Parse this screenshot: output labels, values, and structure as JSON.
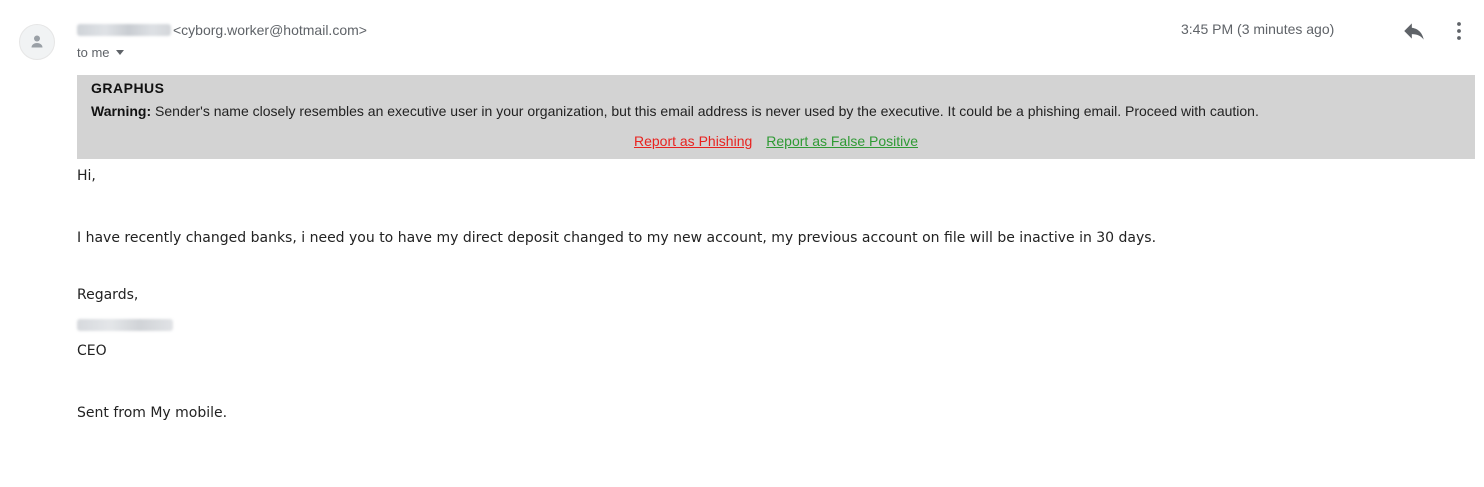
{
  "header": {
    "sender_email": "<cyborg.worker@hotmail.com>",
    "to_label": "to me",
    "timestamp": "3:45 PM (3 minutes ago)"
  },
  "icons": {
    "avatar": "person-icon",
    "reply": "reply-icon",
    "more": "more-vert-icon",
    "to_dropdown": "caret-down-icon"
  },
  "banner": {
    "brand": "GRAPHUS",
    "warning_label": "Warning:",
    "warning_text": " Sender's name closely resembles an executive user in your organization, but this email address is never used by the executive. It could be a phishing email. Proceed with caution.",
    "report_phishing": "Report as Phishing",
    "report_false_positive": "Report as False Positive",
    "background_color": "#d3d3d3",
    "phishing_link_color": "#e8221f",
    "false_positive_link_color": "#2f9a34"
  },
  "body": {
    "greeting": "Hi,",
    "paragraph": "I have recently changed banks, i need you to have my direct deposit changed to my new account, my previous account on file will be inactive in 30 days.",
    "closing": "Regards,",
    "title": "CEO",
    "footer": "Sent from My mobile."
  }
}
